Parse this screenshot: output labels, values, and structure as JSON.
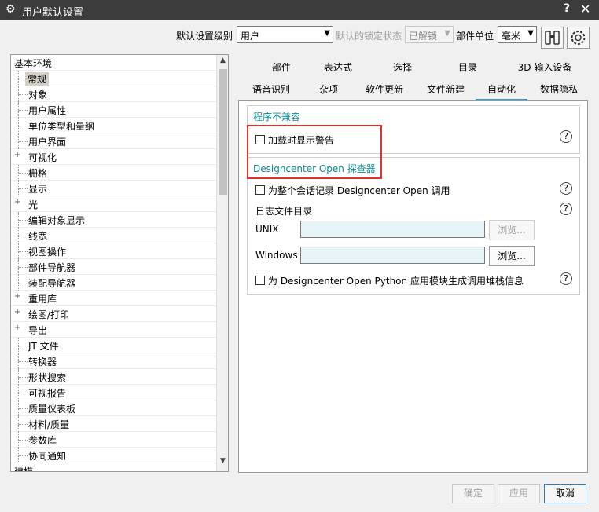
{
  "window": {
    "title": "用户默认设置",
    "help": "?",
    "close": "✕"
  },
  "toolbar": {
    "level_label": "默认设置级别",
    "level_value": "用户",
    "lock_label": "默认的锁定状态",
    "lock_value": "已解锁",
    "units_label": "部件单位",
    "units_value": "毫米"
  },
  "tree": {
    "items": [
      "基本环境",
      "常规",
      "对象",
      "用户属性",
      "单位类型和量纲",
      "用户界面",
      "可视化",
      "栅格",
      "显示",
      "光",
      "编辑对象显示",
      "线宽",
      "视图操作",
      "部件导航器",
      "装配导航器",
      "重用库",
      "绘图/打印",
      "导出",
      "JT 文件",
      "转换器",
      "形状搜索",
      "可视报告",
      "质量仪表板",
      "材料/质量",
      "参数库",
      "协同通知",
      "建模"
    ]
  },
  "tabs": {
    "row1": [
      "部件",
      "表达式",
      "选择",
      "目录",
      "3D 输入设备"
    ],
    "row2": [
      "语音识别",
      "杂项",
      "软件更新",
      "文件新建",
      "自动化",
      "数据隐私"
    ],
    "active": "自动化"
  },
  "panel": {
    "group1_title": "程序不兼容",
    "load_warning_label": "加载时显示警告",
    "group2_title": "Designcenter Open 探查器",
    "record_session_label": "为整个会话记录 Designcenter Open 调用",
    "log_dir_label": "日志文件目录",
    "unix_label": "UNIX",
    "unix_value": "",
    "windows_label": "Windows",
    "windows_value": "",
    "browse_label": "浏览...",
    "python_stack_label": "为 Designcenter Open Python 应用模块生成调用堆栈信息",
    "help_glyph": "?"
  },
  "footer": {
    "ok": "确定",
    "apply": "应用",
    "cancel": "取消"
  },
  "colors": {
    "titlebar": "#3c3c3c",
    "accent": "#2b9bd6",
    "group_title": "#0c8a8f",
    "highlight": "#e03030"
  }
}
